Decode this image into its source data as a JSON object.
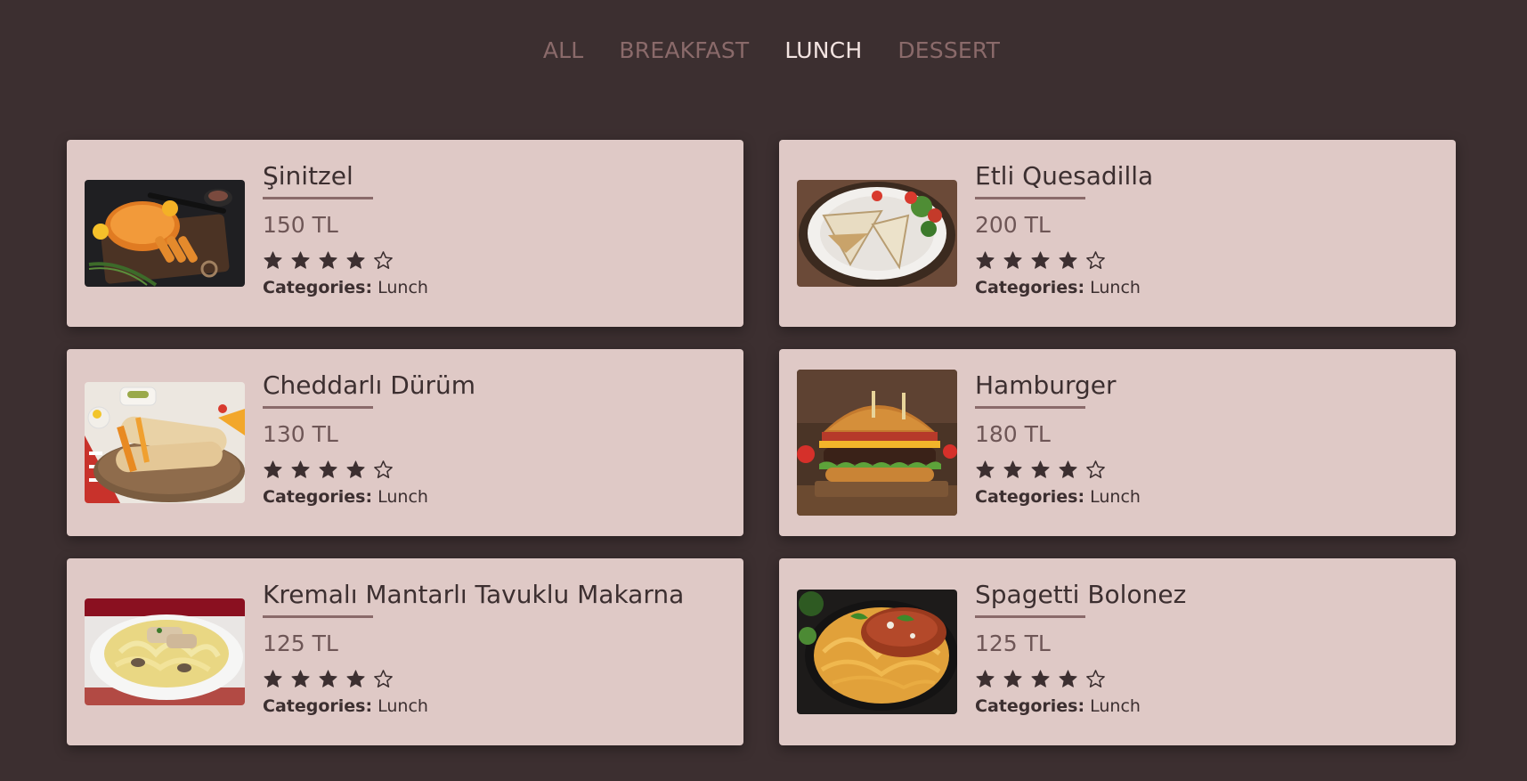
{
  "filters": [
    {
      "label": "ALL"
    },
    {
      "label": "BREAKFAST"
    },
    {
      "label": "LUNCH"
    },
    {
      "label": "DESSERT"
    }
  ],
  "active_filter": "LUNCH",
  "categories_label": "Categories:",
  "colors": {
    "background": "#3c2f30",
    "card": "#dfc9c6",
    "active_filter": "#f3e4e1",
    "inactive_filter": "#8a6a6a"
  },
  "menu": [
    {
      "title": "Şinitzel",
      "price": "150 TL",
      "rating": 4,
      "max_rating": 5,
      "category": "Lunch",
      "image": "schnitzel-image"
    },
    {
      "title": "Etli Quesadilla",
      "price": "200 TL",
      "rating": 4,
      "max_rating": 5,
      "category": "Lunch",
      "image": "quesadilla-image"
    },
    {
      "title": "Cheddarlı Dürüm",
      "price": "130 TL",
      "rating": 4,
      "max_rating": 5,
      "category": "Lunch",
      "image": "durum-image"
    },
    {
      "title": "Hamburger",
      "price": "180 TL",
      "rating": 4,
      "max_rating": 5,
      "category": "Lunch",
      "image": "hamburger-image"
    },
    {
      "title": "Kremalı Mantarlı Tavuklu Makarna",
      "price": "125 TL",
      "rating": 4,
      "max_rating": 5,
      "category": "Lunch",
      "image": "pasta-image"
    },
    {
      "title": "Spagetti Bolonez",
      "price": "125 TL",
      "rating": 4,
      "max_rating": 5,
      "category": "Lunch",
      "image": "spaghetti-image"
    }
  ]
}
